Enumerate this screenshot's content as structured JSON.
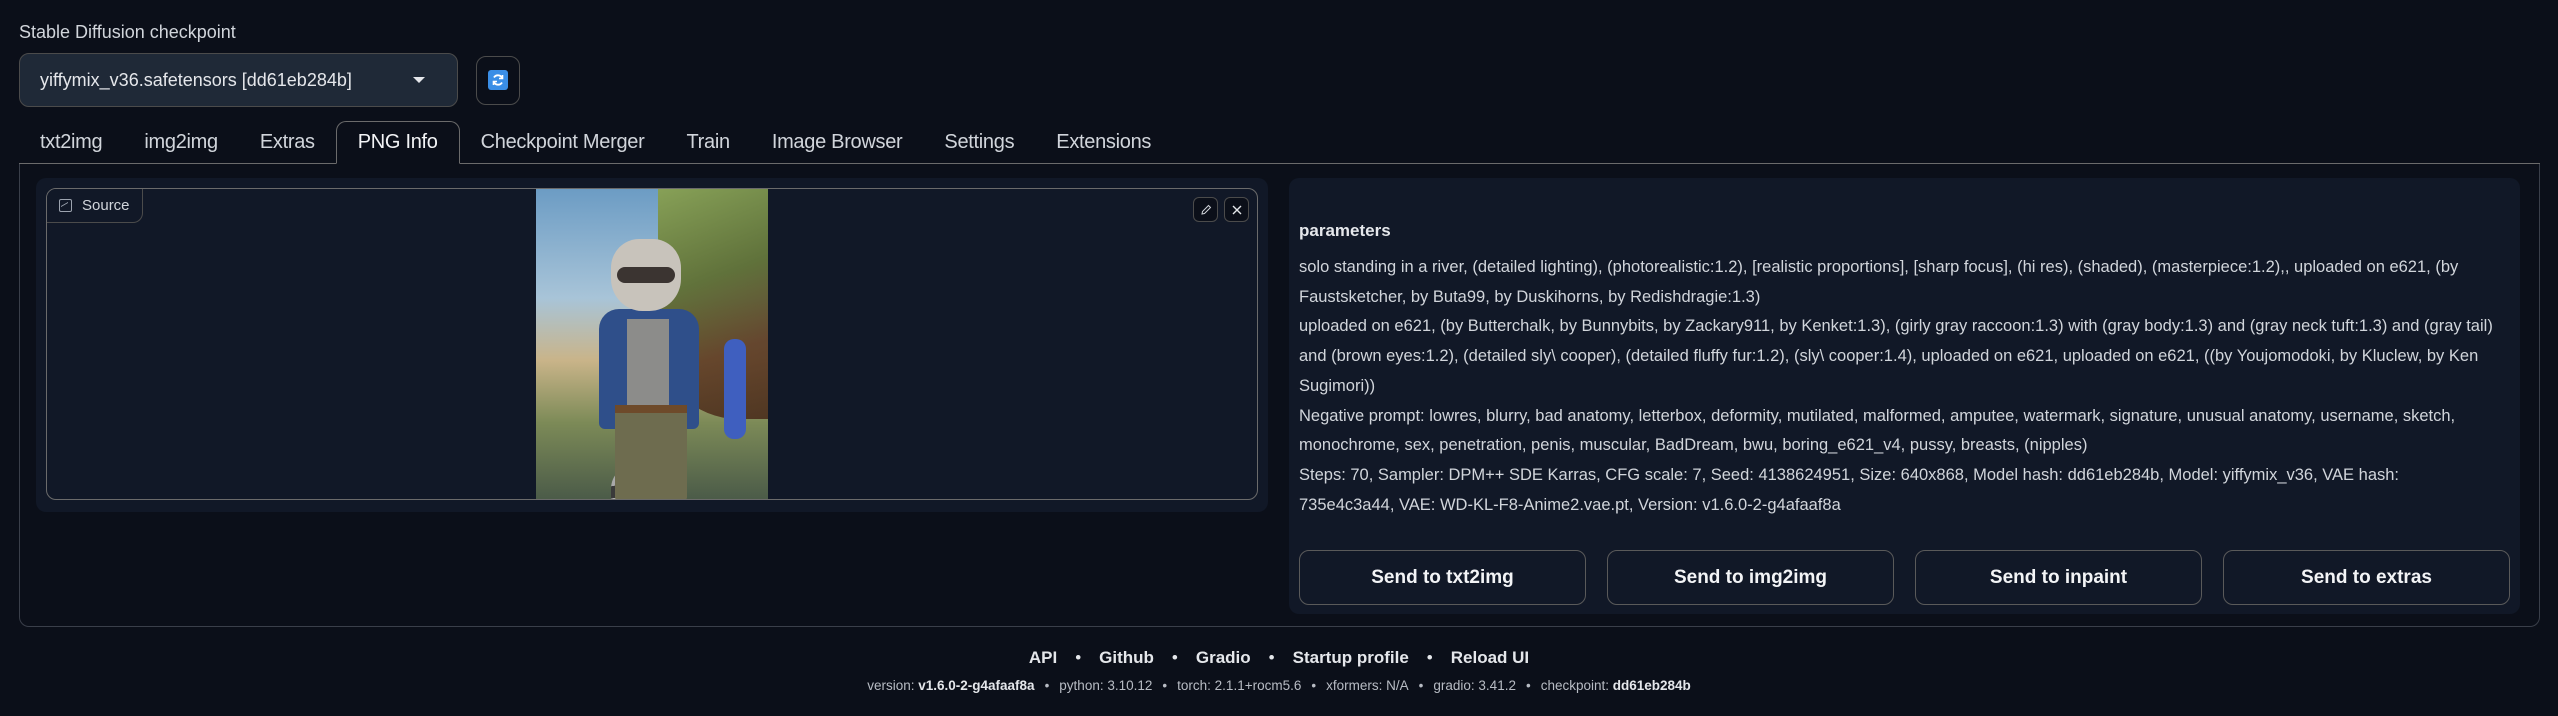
{
  "checkpoint": {
    "label": "Stable Diffusion checkpoint",
    "value": "yiffymix_v36.safetensors [dd61eb284b]",
    "refresh_icon": "refresh-icon"
  },
  "tabs": [
    {
      "label": "txt2img",
      "active": false
    },
    {
      "label": "img2img",
      "active": false
    },
    {
      "label": "Extras",
      "active": false
    },
    {
      "label": "PNG Info",
      "active": true
    },
    {
      "label": "Checkpoint Merger",
      "active": false
    },
    {
      "label": "Train",
      "active": false
    },
    {
      "label": "Image Browser",
      "active": false
    },
    {
      "label": "Settings",
      "active": false
    },
    {
      "label": "Extensions",
      "active": false
    }
  ],
  "source": {
    "label": "Source",
    "icon": "image-icon",
    "edit_icon": "pencil-icon",
    "clear_icon": "close-icon",
    "image_alt": "raccoon character standing in a river"
  },
  "params": {
    "title": "parameters",
    "lines": [
      "solo standing in a river, (detailed lighting), (photorealistic:1.2), [realistic proportions], [sharp focus], (hi res), (shaded), (masterpiece:1.2),, uploaded on e621, (by Faustsketcher, by Buta99, by Duskihorns, by Redishdragie:1.3)",
      "uploaded on e621, (by Butterchalk, by Bunnybits, by Zackary911, by Kenket:1.3), (girly gray raccoon:1.3) with (gray body:1.3) and (gray neck tuft:1.3) and (gray tail) and (brown eyes:1.2), (detailed sly\\ cooper), (detailed fluffy fur:1.2), (sly\\ cooper:1.4), uploaded on e621, uploaded on e621, ((by Youjomodoki, by Kluclew, by Ken Sugimori))",
      "Negative prompt: lowres, blurry, bad anatomy, letterbox, deformity, mutilated, malformed, amputee, watermark, signature, unusual anatomy, username, sketch, monochrome, sex, penetration, penis, muscular, BadDream, bwu, boring_e621_v4, pussy, breasts, (nipples)",
      "Steps: 70, Sampler: DPM++ SDE Karras, CFG scale: 7, Seed: 4138624951, Size: 640x868, Model hash: dd61eb284b, Model: yiffymix_v36, VAE hash: 735e4c3a44, VAE: WD-KL-F8-Anime2.vae.pt, Version: v1.6.0-2-g4afaaf8a"
    ]
  },
  "send_buttons": [
    "Send to txt2img",
    "Send to img2img",
    "Send to inpaint",
    "Send to extras"
  ],
  "footer": {
    "links": [
      "API",
      "Github",
      "Gradio",
      "Startup profile",
      "Reload UI"
    ],
    "separator": "•",
    "versions": [
      {
        "key": "version:",
        "value": "v1.6.0-2-g4afaaf8a",
        "bold": true
      },
      {
        "key": "python:",
        "value": "3.10.12",
        "bold": false
      },
      {
        "key": "torch:",
        "value": "2.1.1+rocm5.6",
        "bold": false
      },
      {
        "key": "xformers:",
        "value": "N/A",
        "bold": false
      },
      {
        "key": "gradio:",
        "value": "3.41.2",
        "bold": false
      },
      {
        "key": "checkpoint:",
        "value": "dd61eb284b",
        "bold": true
      }
    ]
  },
  "colors": {
    "background": "#0b0f19",
    "panel": "#111827",
    "border": "#6b6b6b",
    "text": "#e5e7eb",
    "refresh_accent": "#3a8ee6"
  }
}
